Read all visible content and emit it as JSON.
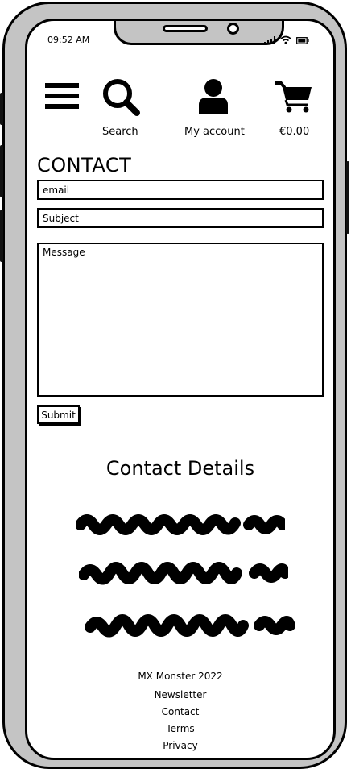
{
  "status_bar": {
    "time": "09:52 AM"
  },
  "header": {
    "search_label": "Search",
    "account_label": "My account",
    "cart_total": "€0.00"
  },
  "page": {
    "title": "CONTACT"
  },
  "form": {
    "email_placeholder": "email",
    "subject_placeholder": "Subject",
    "message_placeholder": "Message",
    "submit_label": "Submit"
  },
  "contact_details": {
    "title": "Contact Details"
  },
  "footer": {
    "copyright": "MX Monster 2022",
    "links": [
      "Newsletter",
      "Contact",
      "Terms",
      "Privacy"
    ]
  },
  "icons": [
    "hamburger-menu-icon",
    "search-icon",
    "user-icon",
    "cart-icon",
    "signal-icon",
    "wifi-icon",
    "battery-icon"
  ]
}
